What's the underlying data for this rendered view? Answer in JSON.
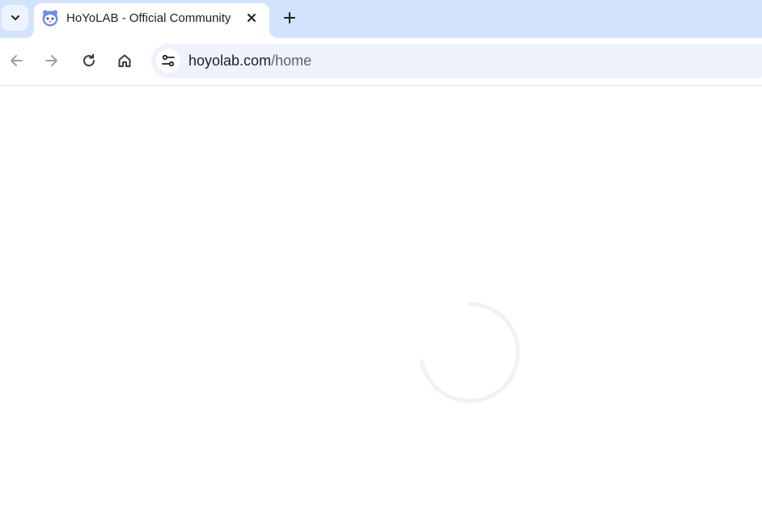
{
  "browser": {
    "tab": {
      "title": "HoYoLAB - Official Community",
      "favicon": "hoyolab-favicon"
    },
    "address_bar": {
      "host": "hoyolab.com",
      "path": "/home"
    },
    "icons": {
      "tab_search": "chevron-down-icon",
      "close": "close-icon",
      "new_tab": "plus-icon",
      "back": "back-arrow-icon",
      "forward": "forward-arrow-icon",
      "reload": "reload-icon",
      "home": "home-icon",
      "site_info": "tune-icon"
    },
    "colors": {
      "tabstrip": "#d3e3fd",
      "omnibox": "#eef3fb",
      "spinner": "#f1f1f1"
    }
  },
  "page": {
    "state": "loading"
  }
}
